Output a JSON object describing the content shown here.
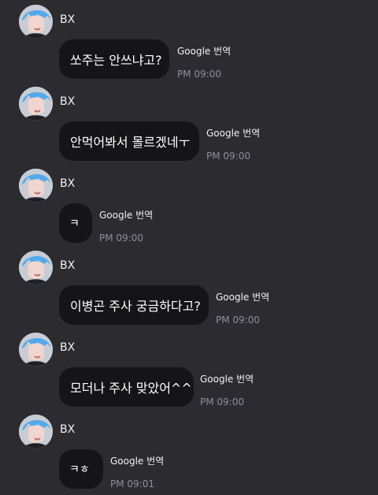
{
  "messages": [
    {
      "sender": "BX",
      "text": "쏘주는 안쓰냐고?",
      "translate": "Google 번역",
      "time": "PM 09:00"
    },
    {
      "sender": "BX",
      "text": "안먹어봐서 몰르겠네ㅜ",
      "translate": "Google 번역",
      "time": "PM 09:00"
    },
    {
      "sender": "BX",
      "text": "ㅋ",
      "translate": "Google 번역",
      "time": "PM 09:00"
    },
    {
      "sender": "BX",
      "text": "이병곤 주사 궁금하다고?",
      "translate": "Google 번역",
      "time": "PM 09:00"
    },
    {
      "sender": "BX",
      "text": "모더나 주사 맞았어^^",
      "translate": "Google 번역",
      "time": "PM 09:00"
    },
    {
      "sender": "BX",
      "text": "ㅋㅎ",
      "translate": "Google 번역",
      "time": "PM 09:01"
    }
  ],
  "colors": {
    "background": "#2b2b30",
    "bubble": "#151518",
    "muted_text": "#8f8f99",
    "text": "#ffffff"
  },
  "icons": {
    "avatar": "profile-photo"
  }
}
